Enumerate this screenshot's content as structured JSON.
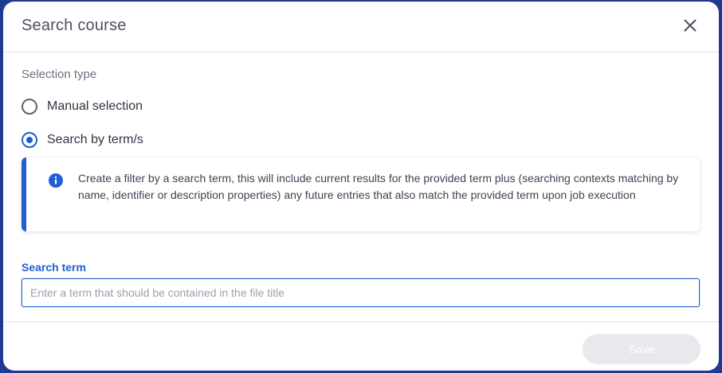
{
  "dialog": {
    "title": "Search course"
  },
  "selection": {
    "label": "Selection type",
    "options": [
      {
        "label": "Manual selection",
        "checked": false
      },
      {
        "label": "Search by term/s",
        "checked": true
      }
    ]
  },
  "info": {
    "icon": "info-icon",
    "text": "Create a filter by a search term, this will include current results for the provided term plus (searching contexts matching by name, identifier or description properties) any future entries that also match the provided term upon job execution"
  },
  "search": {
    "label": "Search term",
    "value": "",
    "placeholder": "Enter a term that should be contained in the file title"
  },
  "footer": {
    "save_label": "Save",
    "save_enabled": false
  },
  "colors": {
    "accent": "#1f5fd1",
    "backdrop": "#1f3a93",
    "disabled_button": "#e7e9ed"
  }
}
